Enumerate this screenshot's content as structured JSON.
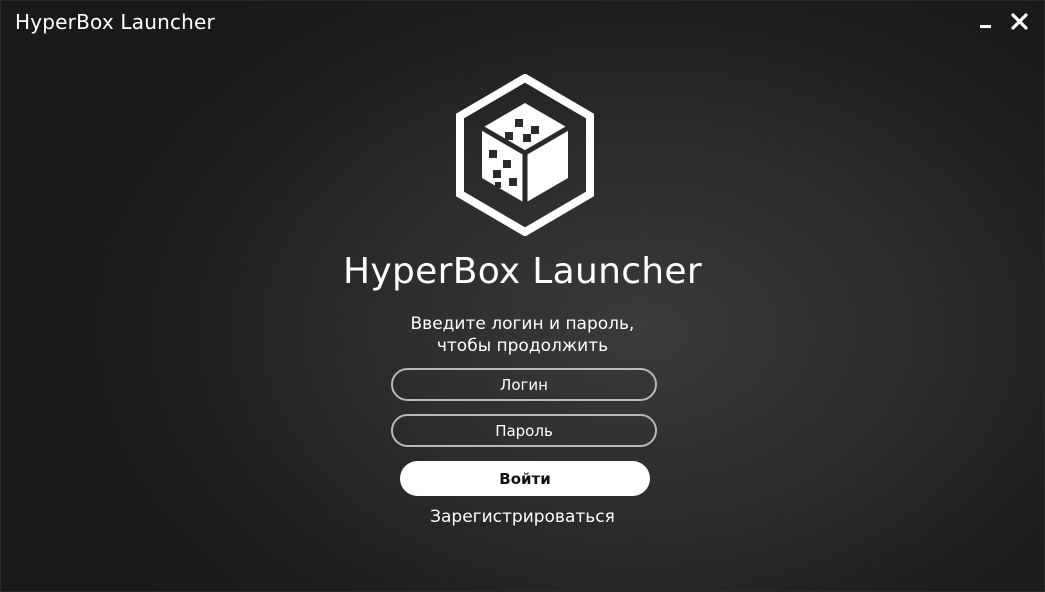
{
  "window": {
    "title": "HyperBox Launcher",
    "controls": {
      "minimize_icon": "minimize-icon",
      "close_icon": "close-icon"
    }
  },
  "brand": {
    "logo_icon": "hexagon-cube-logo",
    "app_name": "HyperBox Launcher"
  },
  "login_form": {
    "prompt_line1": "Введите логин и пароль,",
    "prompt_line2": "чтобы продолжить",
    "login_placeholder": "Логин",
    "password_placeholder": "Пароль",
    "submit_label": "Войти",
    "register_label": "Зарегистрироваться"
  },
  "colors": {
    "background": "#2b2b2b",
    "text": "#ffffff",
    "field_border": "#b9b9b9",
    "button_bg": "#ffffff",
    "button_text": "#111111"
  }
}
